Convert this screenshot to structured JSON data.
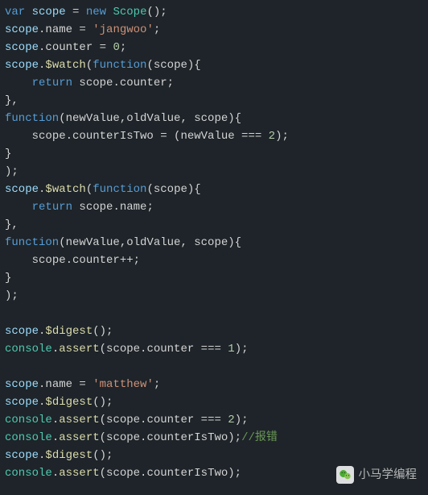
{
  "code": {
    "l1_var": "var",
    "l1_scope": " scope ",
    "l1_eq": "= ",
    "l1_new": "new",
    "l1_sp": " ",
    "l1_type": "Scope",
    "l1_end": "();",
    "l2_a": "scope",
    "l2_b": ".name = ",
    "l2_str": "'jangwoo'",
    "l2_c": ";",
    "l3_a": "scope",
    "l3_b": ".counter = ",
    "l3_num": "0",
    "l3_c": ";",
    "l4_a": "scope",
    "l4_b": ".",
    "l4_m": "$watch",
    "l4_c": "(",
    "l4_fn": "function",
    "l4_d": "(scope){",
    "l5_pad": "    ",
    "l5_ret": "return",
    "l5_b": " scope.counter;",
    "l6": "},",
    "l7_fn": "function",
    "l7_b": "(newValue,oldValue, scope){",
    "l8_pad": "    ",
    "l8_b": "scope.counterIsTwo = (newValue === ",
    "l8_num": "2",
    "l8_c": ");",
    "l9": "}",
    "l10": ");",
    "l11_a": "scope",
    "l11_b": ".",
    "l11_m": "$watch",
    "l11_c": "(",
    "l11_fn": "function",
    "l11_d": "(scope){",
    "l12_pad": "    ",
    "l12_ret": "return",
    "l12_b": " scope.name;",
    "l13": "},",
    "l14_fn": "function",
    "l14_b": "(newValue,oldValue, scope){",
    "l15_pad": "    ",
    "l15_b": "scope.counter++;",
    "l16": "}",
    "l17": ");",
    "l18": "",
    "l19_a": "scope",
    "l19_b": ".",
    "l19_m": "$digest",
    "l19_c": "();",
    "l20_a": "console",
    "l20_b": ".",
    "l20_m": "assert",
    "l20_c": "(scope.counter === ",
    "l20_num": "1",
    "l20_d": ");",
    "l21": "",
    "l22_a": "scope",
    "l22_b": ".name = ",
    "l22_str": "'matthew'",
    "l22_c": ";",
    "l23_a": "scope",
    "l23_b": ".",
    "l23_m": "$digest",
    "l23_c": "();",
    "l24_a": "console",
    "l24_b": ".",
    "l24_m": "assert",
    "l24_c": "(scope.counter === ",
    "l24_num": "2",
    "l24_d": ");",
    "l25_a": "console",
    "l25_b": ".",
    "l25_m": "assert",
    "l25_c": "(scope.counterIsTwo);",
    "l25_cm": "//报错",
    "l26_a": "scope",
    "l26_b": ".",
    "l26_m": "$digest",
    "l26_c": "();",
    "l27_a": "console",
    "l27_b": ".",
    "l27_m": "assert",
    "l27_c": "(scope.counterIsTwo);"
  },
  "watermark": {
    "text": "小马学编程"
  }
}
